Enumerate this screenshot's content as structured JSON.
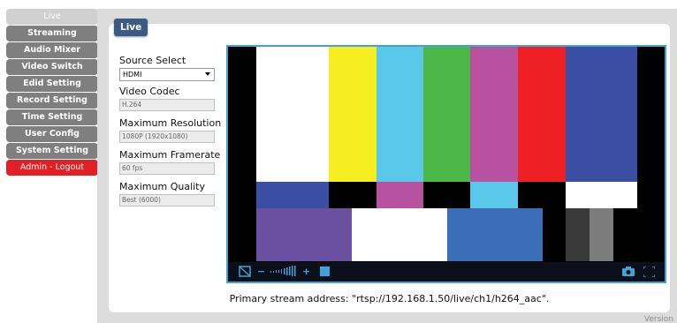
{
  "nav": {
    "items": [
      {
        "label": "Live"
      },
      {
        "label": "Streaming"
      },
      {
        "label": "Audio Mixer"
      },
      {
        "label": "Video Switch"
      },
      {
        "label": "Edid Setting"
      },
      {
        "label": "Record Setting"
      },
      {
        "label": "Time Setting"
      },
      {
        "label": "User Config"
      },
      {
        "label": "System Setting"
      },
      {
        "label": "Admin - Logout"
      }
    ]
  },
  "panel": {
    "title": "Live"
  },
  "form": {
    "source_label": "Source Select",
    "source_value": "HDMI",
    "codec_label": "Video Codec",
    "codec_value": "H.264",
    "resolution_label": "Maximum Resolution",
    "resolution_value": "1080P (1920x1080)",
    "framerate_label": "Maximum Framerate",
    "framerate_value": "60 fps",
    "quality_label": "Maximum Quality",
    "quality_value": "Best (6000)"
  },
  "stream": {
    "text": "Primary stream address: \"rtsp://192.168.1.50/live/ch1/h264_aac\"."
  },
  "footer": {
    "version": "Version"
  },
  "colors": {
    "accent": "#3fa3d6",
    "panel_tab": "#3c5a86",
    "logout": "#e31f26",
    "nav": "#7f7f7f"
  },
  "icons": [
    "mute-icon",
    "volume-down-icon",
    "volume-level-icon",
    "volume-up-icon",
    "stop-icon",
    "snapshot-icon",
    "fullscreen-icon"
  ]
}
